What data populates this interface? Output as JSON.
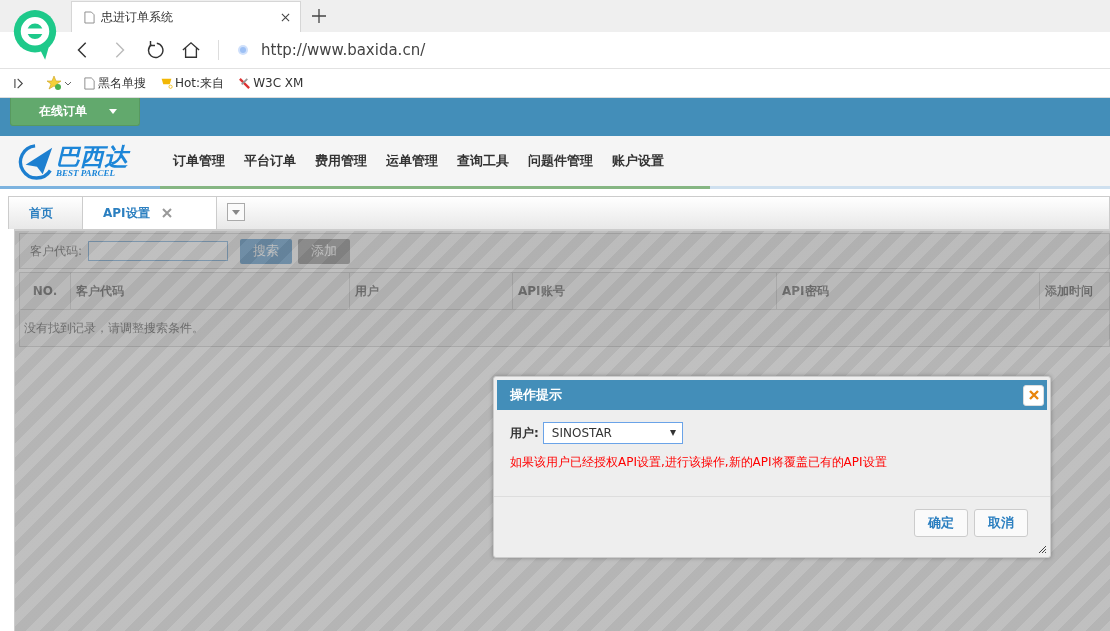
{
  "browser": {
    "tab_title": "忠进订单系统",
    "url": "http://www.baxida.cn/",
    "bookmarks": [
      {
        "label": "黑名单搜",
        "kind": "page"
      },
      {
        "label": "Hot:来自",
        "kind": "bell"
      },
      {
        "label": "W3C XM",
        "kind": "tool"
      }
    ]
  },
  "top_bar": {
    "menu_button": "在线订单"
  },
  "logo": {
    "name": "巴西达",
    "tagline": "BEST PARCEL"
  },
  "nav": [
    "订单管理",
    "平台订单",
    "费用管理",
    "运单管理",
    "查询工具",
    "问题件管理",
    "账户设置"
  ],
  "tabs": [
    {
      "label": "首页",
      "selected": false,
      "closable": false
    },
    {
      "label": "API设置",
      "selected": true,
      "closable": true
    }
  ],
  "search": {
    "label": "客户代码:",
    "search_button": "搜索",
    "add_button": "添加"
  },
  "table": {
    "columns": [
      "NO.",
      "客户代码",
      "用户",
      "API账号",
      "API密码",
      "添加时间"
    ],
    "empty_message": "没有找到记录，请调整搜索条件。"
  },
  "dialog": {
    "title": "操作提示",
    "user_label": "用户:",
    "user_value": "SINOSTAR",
    "warning": "如果该用户已经授权API设置,进行该操作,新的API将覆盖已有的API设置",
    "buttons": [
      "确定",
      "取消"
    ]
  }
}
